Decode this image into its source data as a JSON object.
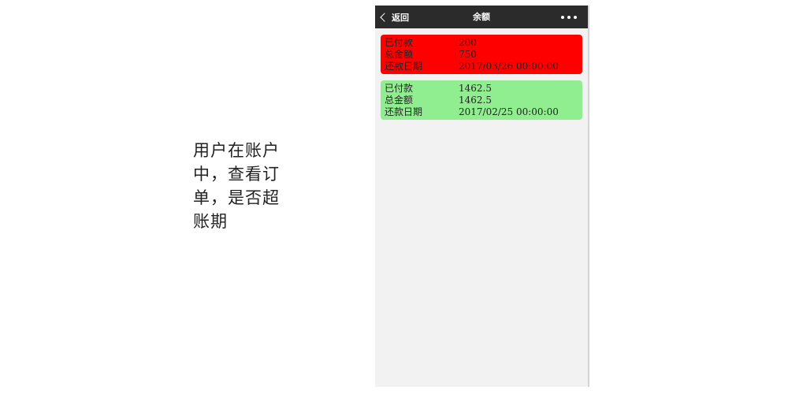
{
  "caption": "用户在账户中，查看订单，是否超账期",
  "phone": {
    "nav": {
      "back_label": "返回",
      "title": "余额",
      "more_icon": "more-dots-icon",
      "back_icon": "chevron-left-icon"
    },
    "colors": {
      "overdue": "#ff0000",
      "ok": "#90ee90",
      "nav_bg": "#2b2b2b"
    },
    "cards": [
      {
        "status": "overdue",
        "rows": [
          {
            "label": "已付款",
            "value": "200"
          },
          {
            "label": "总金额",
            "value": "750"
          },
          {
            "label": "还款日期",
            "value": "2017/03/26 00:00:00"
          }
        ]
      },
      {
        "status": "ok",
        "rows": [
          {
            "label": "已付款",
            "value": "1462.5"
          },
          {
            "label": "总金额",
            "value": "1462.5"
          },
          {
            "label": "还款日期",
            "value": "2017/02/25 00:00:00"
          }
        ]
      }
    ]
  }
}
